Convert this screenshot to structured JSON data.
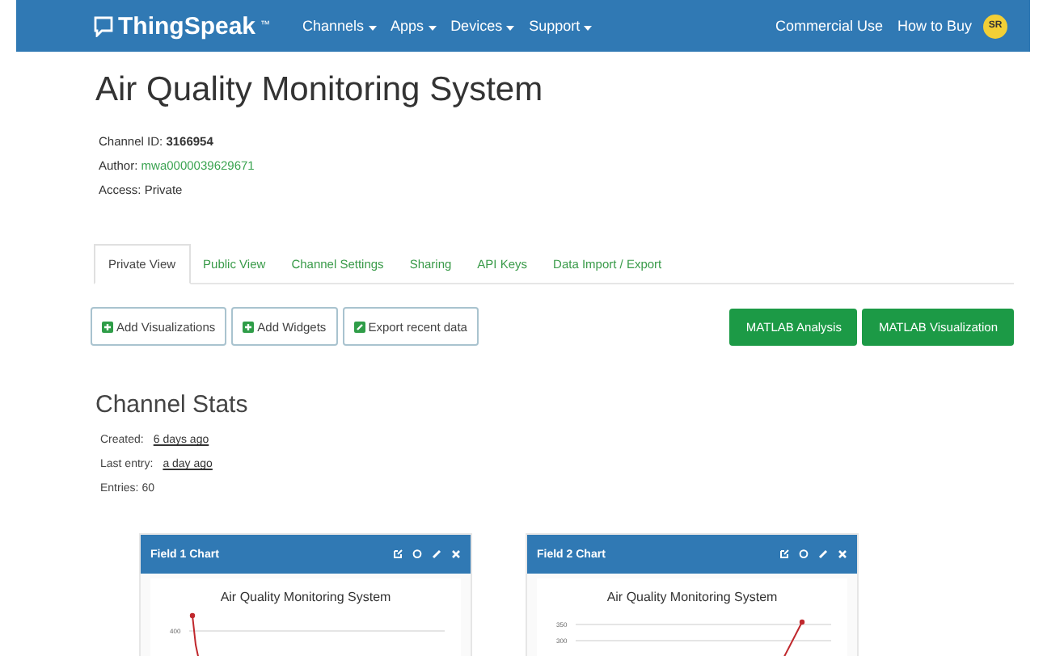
{
  "navbar": {
    "brand": "ThingSpeak",
    "trademark": "™",
    "menus": [
      {
        "label": "Channels"
      },
      {
        "label": "Apps"
      },
      {
        "label": "Devices"
      },
      {
        "label": "Support"
      }
    ],
    "links": [
      "Commercial Use",
      "How to Buy"
    ],
    "avatar": "SR"
  },
  "channel": {
    "title": "Air Quality Monitoring System",
    "id_label": "Channel ID:",
    "id": "3166954",
    "author_label": "Author:",
    "author": "mwa0000039629671",
    "access_label": "Access:",
    "access": "Private"
  },
  "tabs": [
    {
      "label": "Private View",
      "selected": true
    },
    {
      "label": "Public View",
      "selected": false
    },
    {
      "label": "Channel Settings",
      "selected": false
    },
    {
      "label": "Sharing",
      "selected": false
    },
    {
      "label": "API Keys",
      "selected": false
    },
    {
      "label": "Data Import / Export",
      "selected": false
    }
  ],
  "actions": [
    {
      "label": "Add Visualizations",
      "kind": "plus"
    },
    {
      "label": "Add Widgets",
      "kind": "plus"
    },
    {
      "label": "Export recent data",
      "kind": "edit"
    }
  ],
  "matlab_buttons": [
    "MATLAB Analysis",
    "MATLAB Visualization"
  ],
  "stats": {
    "title": "Channel Stats",
    "created_label": "Created:",
    "created": "6 days ago",
    "last_entry_label": "Last entry:",
    "last_entry": "a day ago",
    "entries_label": "Entries:",
    "entries": "60"
  },
  "charts": [
    {
      "header": "Field 1 Chart",
      "title": "Air Quality Monitoring System",
      "y_labels": [
        "400"
      ]
    },
    {
      "header": "Field 2 Chart",
      "title": "Air Quality Monitoring System",
      "y_labels": [
        "350",
        "300"
      ]
    }
  ]
}
